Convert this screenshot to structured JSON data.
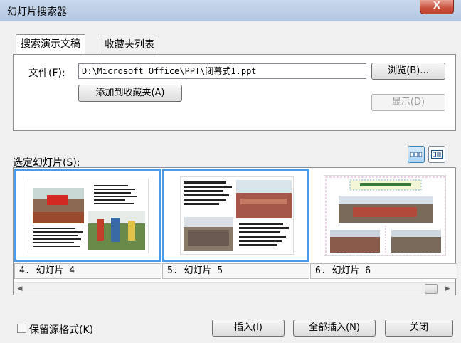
{
  "window": {
    "title": "幻灯片搜索器",
    "close_label": "X"
  },
  "tabs": [
    {
      "label": "搜索演示文稿",
      "active": true
    },
    {
      "label": "收藏夹列表",
      "active": false
    }
  ],
  "file": {
    "label": "文件(F):",
    "value": "D:\\Microsoft Office\\PPT\\闭幕式1.ppt",
    "browse_label": "浏览(B)...",
    "add_favorites_label": "添加到收藏夹(A)",
    "show_label": "显示(D)"
  },
  "slides_section": {
    "label": "选定幻灯片(S):",
    "view_modes": [
      {
        "icon": "thumbnail-view-icon",
        "active": true
      },
      {
        "icon": "title-list-view-icon",
        "active": false
      }
    ]
  },
  "slides": [
    {
      "caption": "4. 幻灯片 4",
      "selected": true
    },
    {
      "caption": "5. 幻灯片 5",
      "selected": true
    },
    {
      "caption": "6. 幻灯片 6",
      "selected": false
    }
  ],
  "scrollbar": {
    "left_icon": "◀",
    "right_icon": "▶"
  },
  "footer": {
    "keep_format_label": "保留源格式(K)",
    "keep_format_checked": false,
    "insert_label": "插入(I)",
    "insert_all_label": "全部插入(N)",
    "close_label": "关闭"
  },
  "colors": {
    "selection": "#4a9ce8",
    "titlebar": "#c9d8ec",
    "close": "#c7503a"
  }
}
